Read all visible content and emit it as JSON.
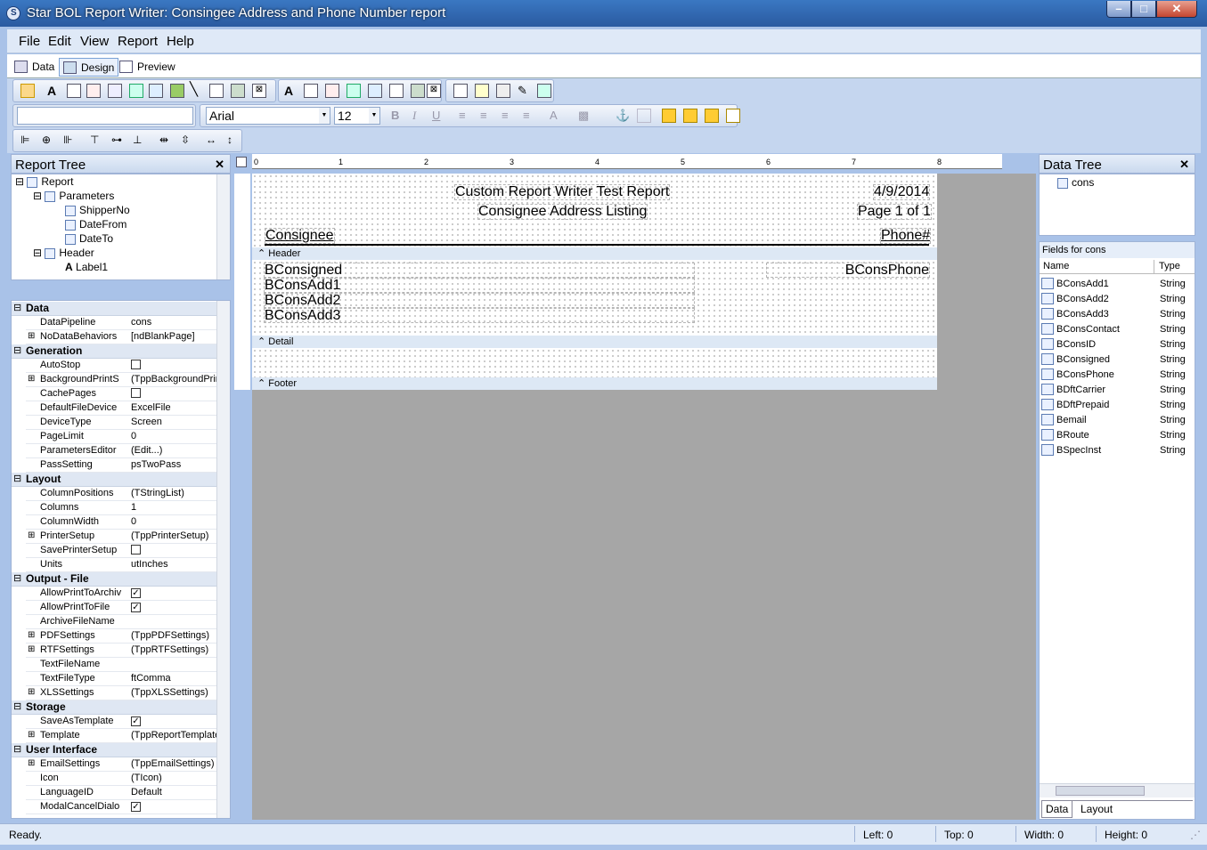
{
  "window": {
    "title": "Star BOL Report Writer: Consingee Address and Phone Number report"
  },
  "menu": [
    "File",
    "Edit",
    "View",
    "Report",
    "Help"
  ],
  "tabs": [
    "Data",
    "Design",
    "Preview"
  ],
  "font": {
    "name": "Arial",
    "size": "12"
  },
  "report_tree": {
    "title": "Report Tree",
    "nodes": [
      "Report",
      "Parameters",
      "ShipperNo",
      "DateFrom",
      "DateTo",
      "Header",
      "Label1"
    ]
  },
  "props": {
    "categories": {
      "data": "Data",
      "generation": "Generation",
      "layout": "Layout",
      "output": "Output - File",
      "storage": "Storage",
      "ui": "User Interface"
    },
    "rows": {
      "data_pipeline": {
        "name": "DataPipeline",
        "value": "cons"
      },
      "no_data": {
        "name": "NoDataBehaviors",
        "value": "[ndBlankPage]"
      },
      "autostop": {
        "name": "AutoStop",
        "value": ""
      },
      "bg_print": {
        "name": "BackgroundPrintS",
        "value": "(TppBackgroundPrintS"
      },
      "cache_pages": {
        "name": "CachePages",
        "value": ""
      },
      "default_file": {
        "name": "DefaultFileDevice",
        "value": "ExcelFile"
      },
      "device_type": {
        "name": "DeviceType",
        "value": "Screen"
      },
      "page_limit": {
        "name": "PageLimit",
        "value": "0"
      },
      "param_editor": {
        "name": "ParametersEditor",
        "value": "(Edit...)"
      },
      "pass_setting": {
        "name": "PassSetting",
        "value": "psTwoPass"
      },
      "col_positions": {
        "name": "ColumnPositions",
        "value": "(TStringList)"
      },
      "columns": {
        "name": "Columns",
        "value": "1"
      },
      "col_width": {
        "name": "ColumnWidth",
        "value": "0"
      },
      "printer_setup": {
        "name": "PrinterSetup",
        "value": "(TppPrinterSetup)"
      },
      "save_printer": {
        "name": "SavePrinterSetup",
        "value": ""
      },
      "units": {
        "name": "Units",
        "value": "utInches"
      },
      "allow_archive": {
        "name": "AllowPrintToArchiv",
        "value": ""
      },
      "allow_file": {
        "name": "AllowPrintToFile",
        "value": ""
      },
      "archive_name": {
        "name": "ArchiveFileName",
        "value": ""
      },
      "pdf": {
        "name": "PDFSettings",
        "value": "(TppPDFSettings)"
      },
      "rtf": {
        "name": "RTFSettings",
        "value": "(TppRTFSettings)"
      },
      "text_name": {
        "name": "TextFileName",
        "value": ""
      },
      "text_type": {
        "name": "TextFileType",
        "value": "ftComma"
      },
      "xls": {
        "name": "XLSSettings",
        "value": "(TppXLSSettings)"
      },
      "save_template": {
        "name": "SaveAsTemplate",
        "value": ""
      },
      "template": {
        "name": "Template",
        "value": "(TppReportTemplate)"
      },
      "email": {
        "name": "EmailSettings",
        "value": "(TppEmailSettings)"
      },
      "icon": {
        "name": "Icon",
        "value": "(TIcon)"
      },
      "language": {
        "name": "LanguageID",
        "value": "Default"
      },
      "modal_cancel": {
        "name": "ModalCancelDialo",
        "value": ""
      }
    }
  },
  "ruler": [
    "0",
    "1",
    "2",
    "3",
    "4",
    "5",
    "6",
    "7",
    "8"
  ],
  "report": {
    "title": "Custom Report Writer Test Report",
    "date": "4/9/2014",
    "subtitle": "Consignee Address Listing",
    "page": "Page 1 of 1",
    "col_consignee": "Consignee",
    "col_phone": "Phone#",
    "bands": {
      "header": "Header",
      "detail": "Detail",
      "footer": "Footer"
    },
    "fields": {
      "consigned": "BConsigned",
      "phone": "BConsPhone",
      "add1": "BConsAdd1",
      "add2": "BConsAdd2",
      "add3": "BConsAdd3"
    }
  },
  "data_tree": {
    "title": "Data Tree",
    "pipeline": "cons",
    "fields_title": "Fields for cons",
    "col_name": "Name",
    "col_type": "Type",
    "fields": [
      {
        "name": "BConsAdd1",
        "type": "String"
      },
      {
        "name": "BConsAdd2",
        "type": "String"
      },
      {
        "name": "BConsAdd3",
        "type": "String"
      },
      {
        "name": "BConsContact",
        "type": "String"
      },
      {
        "name": "BConsID",
        "type": "String"
      },
      {
        "name": "BConsigned",
        "type": "String"
      },
      {
        "name": "BConsPhone",
        "type": "String"
      },
      {
        "name": "BDftCarrier",
        "type": "String"
      },
      {
        "name": "BDftPrepaid",
        "type": "String"
      },
      {
        "name": "Bemail",
        "type": "String"
      },
      {
        "name": "BRoute",
        "type": "String"
      },
      {
        "name": "BSpecInst",
        "type": "String"
      }
    ],
    "tabs": [
      "Data",
      "Layout"
    ]
  },
  "status": {
    "text": "Ready.",
    "left": "Left: 0",
    "top": "Top: 0",
    "width": "Width: 0",
    "height": "Height: 0"
  }
}
